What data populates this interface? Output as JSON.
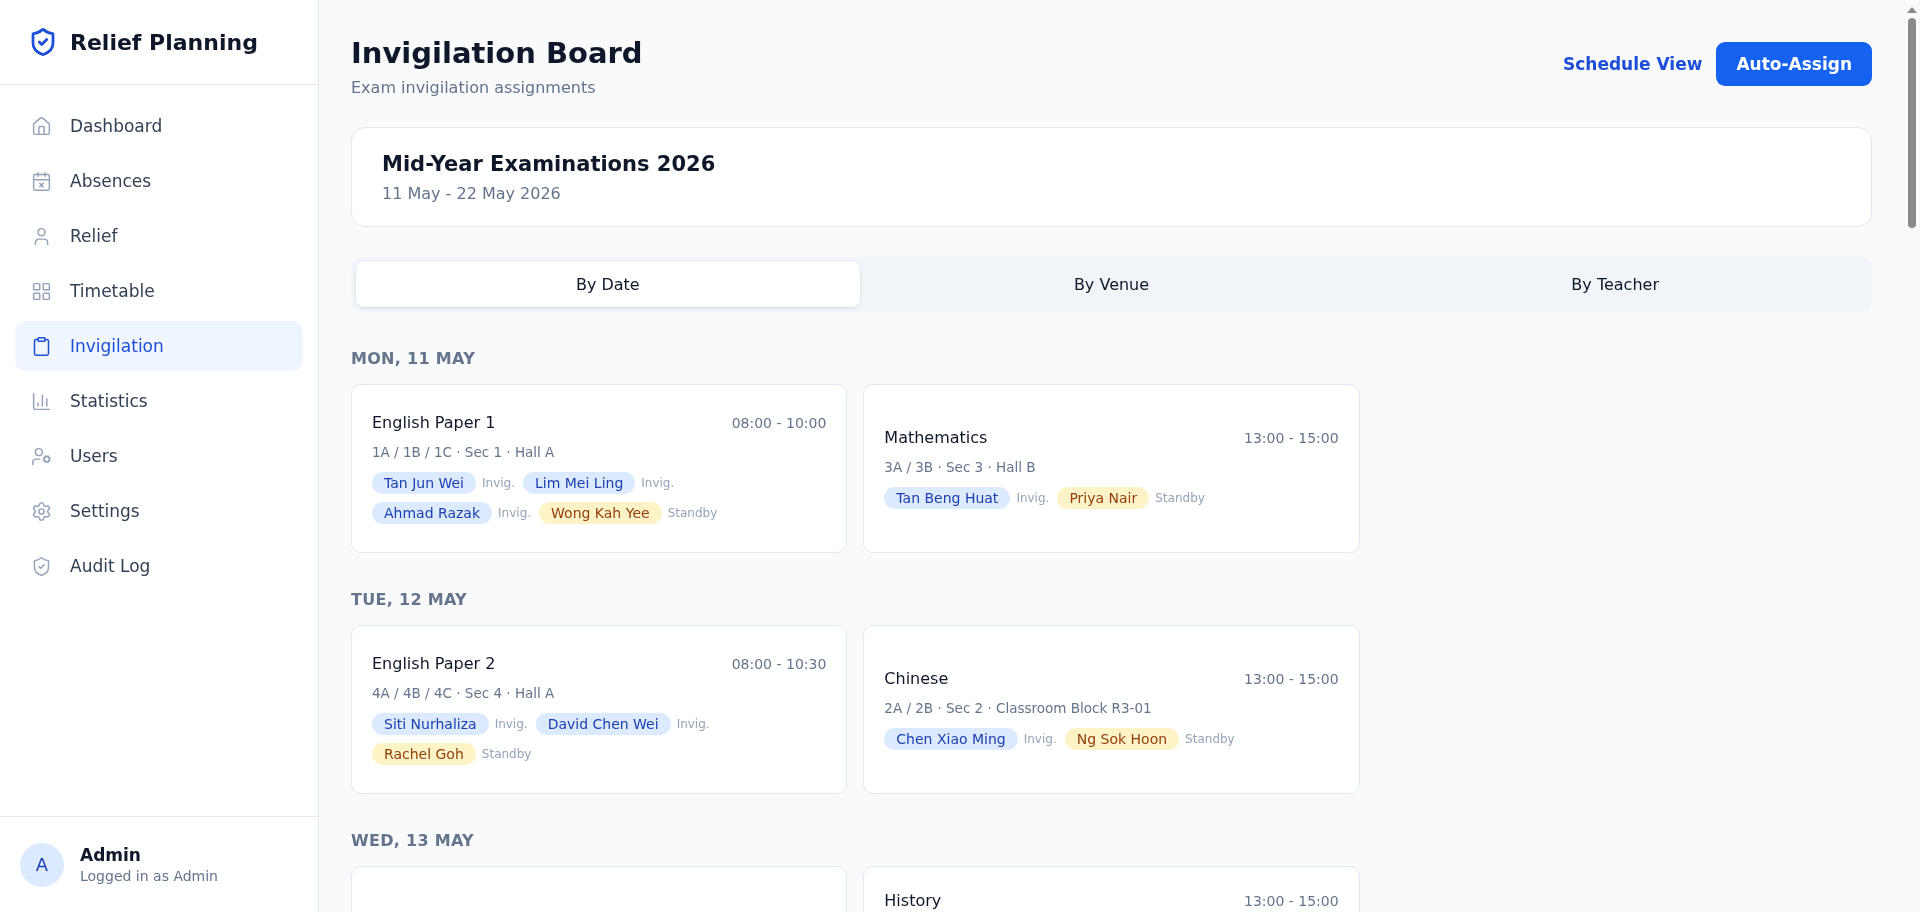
{
  "sidebar": {
    "brand": "Relief Planning",
    "items": [
      {
        "label": "Dashboard",
        "selected": false
      },
      {
        "label": "Absences",
        "selected": false
      },
      {
        "label": "Relief",
        "selected": false
      },
      {
        "label": "Timetable",
        "selected": false
      },
      {
        "label": "Invigilation",
        "selected": true
      },
      {
        "label": "Statistics",
        "selected": false
      },
      {
        "label": "Users",
        "selected": false
      },
      {
        "label": "Settings",
        "selected": false
      },
      {
        "label": "Audit Log",
        "selected": false
      }
    ],
    "user": {
      "initial": "A",
      "name": "Admin",
      "role": "Logged in as Admin"
    }
  },
  "header": {
    "title": "Invigilation Board",
    "subtitle": "Exam invigilation assignments",
    "actions": [
      {
        "label": "Schedule View",
        "kind": "link"
      },
      {
        "label": "Auto-Assign",
        "kind": "primary"
      }
    ]
  },
  "exam_period": {
    "title": "Mid-Year Examinations 2026",
    "dates": "11 May - 22 May 2026"
  },
  "tabs": [
    {
      "label": "By Date",
      "selected": true
    },
    {
      "label": "By Venue",
      "selected": false
    },
    {
      "label": "By Teacher",
      "selected": false
    }
  ],
  "days": [
    {
      "heading": "MON, 11 MAY",
      "exams": [
        {
          "subject": "English Paper 1",
          "time": "08:00 - 10:00",
          "details": "1A / 1B / 1C · Sec 1 · Hall A",
          "staff": [
            {
              "name": "Tan Jun Wei",
              "role": "Invig.",
              "kind": "invigilator"
            },
            {
              "name": "Lim Mei Ling",
              "role": "Invig.",
              "kind": "invigilator"
            },
            {
              "name": "Ahmad Razak",
              "role": "Invig.",
              "kind": "invigilator"
            },
            {
              "name": "Wong Kah Yee",
              "role": "Standby",
              "kind": "standby"
            }
          ]
        },
        {
          "subject": "Mathematics",
          "time": "13:00 - 15:00",
          "details": "3A / 3B · Sec 3 · Hall B",
          "staff": [
            {
              "name": "Tan Beng Huat",
              "role": "Invig.",
              "kind": "invigilator"
            },
            {
              "name": "Priya Nair",
              "role": "Standby",
              "kind": "standby"
            }
          ]
        }
      ]
    },
    {
      "heading": "TUE, 12 MAY",
      "exams": [
        {
          "subject": "English Paper 2",
          "time": "08:00 - 10:30",
          "details": "4A / 4B / 4C · Sec 4 · Hall A",
          "staff": [
            {
              "name": "Siti Nurhaliza",
              "role": "Invig.",
              "kind": "invigilator"
            },
            {
              "name": "David Chen Wei",
              "role": "Invig.",
              "kind": "invigilator"
            },
            {
              "name": "Rachel Goh",
              "role": "Standby",
              "kind": "standby"
            }
          ]
        },
        {
          "subject": "Chinese",
          "time": "13:00 - 15:00",
          "details": "2A / 2B · Sec 2 · Classroom Block R3-01",
          "staff": [
            {
              "name": "Chen Xiao Ming",
              "role": "Invig.",
              "kind": "invigilator"
            },
            {
              "name": "Ng Sok Hoon",
              "role": "Standby",
              "kind": "standby"
            }
          ]
        }
      ]
    },
    {
      "heading": "WED, 13 MAY",
      "exams": [
        {
          "kind": "cut_off"
        },
        {
          "kind": "cut_off",
          "subject": "History",
          "time": "13:00 - 15:00"
        }
      ]
    }
  ]
}
